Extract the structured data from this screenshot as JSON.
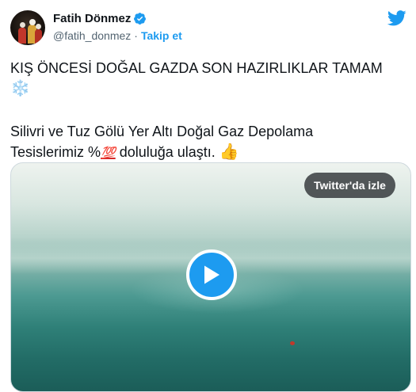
{
  "author": {
    "name": "Fatih Dönmez",
    "handle": "@fatih_donmez",
    "separator": "·",
    "follow_label": "Takip et"
  },
  "tweet": {
    "line1": "KIŞ ÖNCESİ DOĞAL GAZDA SON HAZIRLIKLAR TAMAM",
    "snowflake": "❄️",
    "line2": "Silivri ve Tuz Gölü Yer Altı Doğal Gaz Depolama",
    "line3_start": "Tesislerimiz %",
    "hundred": "💯",
    "line3_end": " doluluğa ulaştı. ",
    "thumbs": "👍"
  },
  "media": {
    "watch_label": "Twitter'da izle"
  },
  "colors": {
    "accent": "#1d9bf0",
    "text": "#0f1419",
    "muted": "#536471"
  },
  "icons": {
    "verified": "verified-badge-icon",
    "logo": "twitter-bird-icon",
    "play": "play-icon"
  }
}
